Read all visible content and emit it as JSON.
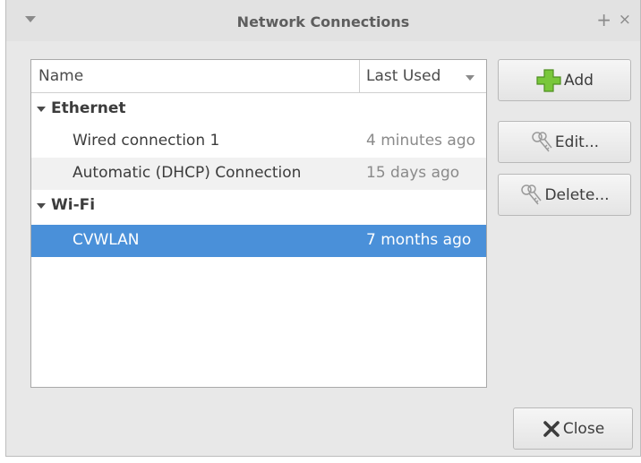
{
  "window": {
    "title": "Network Connections",
    "maximize_glyph": "+",
    "close_glyph": "×"
  },
  "table": {
    "col_name": "Name",
    "col_last_used": "Last Used",
    "groups": [
      {
        "label": "Ethernet",
        "rows": [
          {
            "name": "Wired connection 1",
            "last_used": "4 minutes ago"
          },
          {
            "name": "Automatic (DHCP) Connection",
            "last_used": "15 days ago"
          }
        ]
      },
      {
        "label": "Wi-Fi",
        "rows": [
          {
            "name": "CVWLAN",
            "last_used": "7 months ago",
            "selected": true
          }
        ]
      }
    ]
  },
  "buttons": {
    "add": "Add",
    "edit": "Edit...",
    "delete": "Delete...",
    "close": "Close"
  },
  "icons": {
    "add": "plus-icon",
    "edit": "keys-icon",
    "delete": "keys-icon",
    "close": "x-icon",
    "menu": "chevron-down-icon",
    "sort": "sort-down-icon"
  },
  "colors": {
    "selection": "#4a90d9",
    "add_green": "#79c73b"
  }
}
